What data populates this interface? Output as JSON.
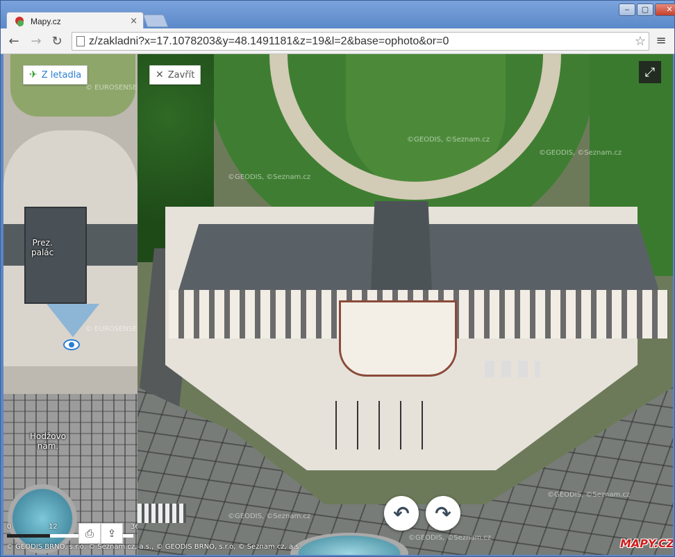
{
  "browser": {
    "tab_title": "Mapy.cz",
    "tab_close": "×",
    "url": "z/zakladni?x=17.1078203&y=48.1491181&z=19&l=2&base=ophoto&or=0",
    "win_min": "‒",
    "win_max": "▢",
    "win_close": "✕",
    "back": "←",
    "forward": "→",
    "reload": "↻",
    "star": "☆",
    "menu": "≡"
  },
  "left_panel": {
    "aerial_button_label": "Z letadla",
    "label_palace": "Prez.\npalác",
    "label_square": "Hodžovo\nnám.",
    "watermark1": "© EUROSENSE",
    "watermark2": "© EUROSENSE",
    "scale": {
      "n0": "0",
      "n1": "12",
      "n2": "36"
    },
    "print_icon": "⎙",
    "share_icon": "⇪"
  },
  "aerial_panel": {
    "close_button_label": "Zavřít",
    "close_icon": "✕",
    "expand_icon": "⤢",
    "rotate_left_icon": "↶",
    "rotate_right_icon": "↷",
    "watermarks": [
      "©GEODIS, ©Seznam.cz",
      "©GEODIS, ©Seznam.cz",
      "©GEODIS, ©Seznam.cz",
      "©GEODIS, ©Seznam.cz",
      "©GEODIS, ©Seznam.cz",
      "©GEODIS, ©Seznam.cz"
    ],
    "logo": "MAPY.CZ"
  },
  "copyright": "© GEODIS BRNO, s.r.o, © Seznam.cz, a.s., © GEODIS BRNO, s.r.o, © Seznam.cz, a.s.",
  "colors": {
    "accent": "#2a7fd4",
    "plane_icon": "#2d9b2d",
    "logo_red": "#d21d1d"
  }
}
